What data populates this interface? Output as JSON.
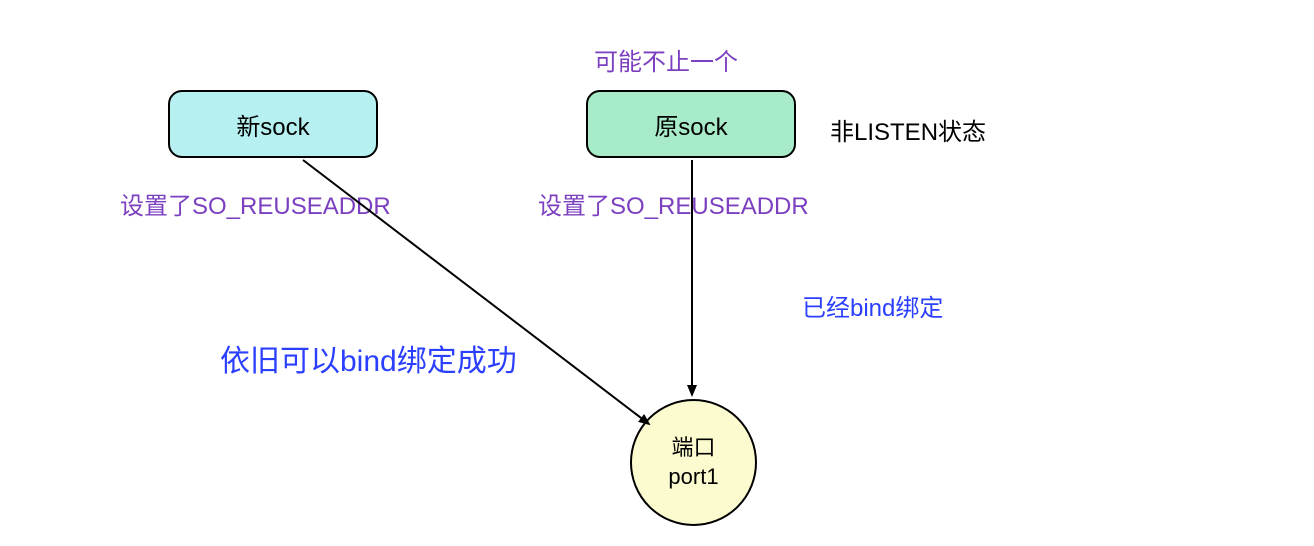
{
  "nodes": {
    "new_sock": {
      "label": "新sock",
      "fill": "#b6f0f0"
    },
    "orig_sock": {
      "label": "原sock",
      "fill": "#a7ebc9"
    },
    "port": {
      "line1": "端口",
      "line2": "port1",
      "fill": "#fbfbcf"
    }
  },
  "labels": {
    "maybe_more": "可能不止一个",
    "non_listen": "非LISTEN状态",
    "new_sock_reuseaddr": "设置了SO_REUSEADDR",
    "orig_sock_reuseaddr": "设置了SO_REUSEADDR",
    "already_bound": "已经bind绑定",
    "bind_success": "依旧可以bind绑定成功"
  },
  "colors": {
    "purple": "#7b3fbf",
    "blue": "#2b3fff",
    "black": "#000000"
  }
}
